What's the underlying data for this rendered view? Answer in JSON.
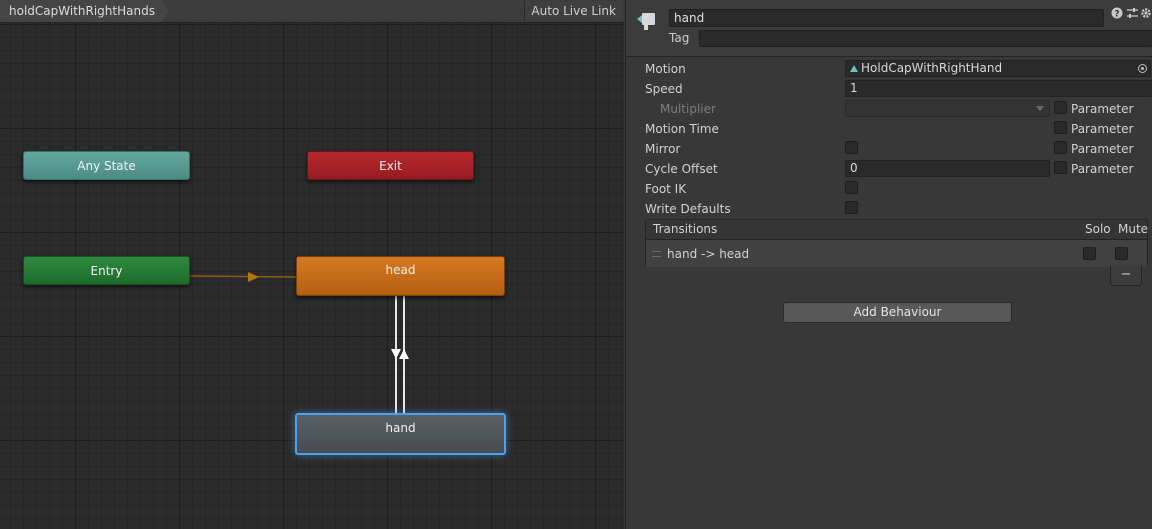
{
  "graph": {
    "breadcrumb": "holdCapWithRightHands",
    "auto_live_link": "Auto Live Link",
    "nodes": {
      "any_state": "Any State",
      "exit": "Exit",
      "entry": "Entry",
      "head": "head",
      "hand": "hand"
    }
  },
  "inspector": {
    "state_name": "hand",
    "tag_label": "Tag",
    "tag_value": "",
    "icons": [
      "help-icon",
      "presets-icon",
      "settings-icon"
    ],
    "motion_label": "Motion",
    "motion_value": "HoldCapWithRightHand",
    "speed_label": "Speed",
    "speed_value": "1",
    "multiplier_label": "Multiplier",
    "motion_time_label": "Motion Time",
    "mirror_label": "Mirror",
    "cycle_offset_label": "Cycle Offset",
    "cycle_offset_value": "0",
    "foot_ik_label": "Foot IK",
    "write_defaults_label": "Write Defaults",
    "parameter_label": "Parameter",
    "transitions": {
      "header": "Transitions",
      "solo": "Solo",
      "mute": "Mute",
      "rows": [
        "hand -> head"
      ]
    },
    "remove_label": "−",
    "add_behaviour": "Add Behaviour"
  },
  "colors": {
    "any_state": "#5a9e95",
    "exit": "#a82127",
    "entry": "#25793a",
    "head": "#c66b1a",
    "hand": "#51565c",
    "selection": "#4aa0ee"
  }
}
